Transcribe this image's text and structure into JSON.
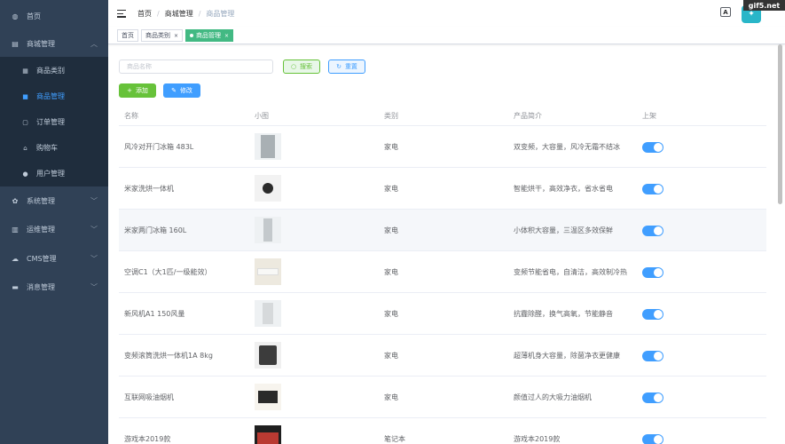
{
  "sidebar": {
    "menu": [
      {
        "label": "首页",
        "icon": "dashboard-icon"
      },
      {
        "label": "商城管理",
        "icon": "shop-icon"
      },
      {
        "label": "系统管理",
        "icon": "gear-icon"
      },
      {
        "label": "运维管理",
        "icon": "monitor-icon"
      },
      {
        "label": "CMS管理",
        "icon": "cloud-icon"
      },
      {
        "label": "消息管理",
        "icon": "message-icon"
      }
    ],
    "submenu": [
      {
        "label": "商品类别",
        "icon": "category-icon"
      },
      {
        "label": "商品管理",
        "icon": "goods-icon"
      },
      {
        "label": "订单管理",
        "icon": "order-icon"
      },
      {
        "label": "购物车",
        "icon": "cart-icon"
      },
      {
        "label": "用户管理",
        "icon": "user-icon"
      }
    ]
  },
  "header": {
    "breadcrumb": [
      "首页",
      "商城管理",
      "商品管理"
    ],
    "breadcrumb_sep": "/",
    "lang_icon_text": "A",
    "watermark": "gif5.net"
  },
  "tags": [
    {
      "label": "首页"
    },
    {
      "label": "商品类别",
      "close": "×"
    },
    {
      "label": "商品管理",
      "close": "×"
    }
  ],
  "toolbar": {
    "search_placeholder": "商品名称",
    "search_label": "搜索",
    "reset_label": "重置",
    "add_label": "添加",
    "edit_label": "修改"
  },
  "table": {
    "columns": [
      "名称",
      "小图",
      "类别",
      "产品简介",
      "上架"
    ],
    "rows": [
      {
        "name": "风冷对开门冰箱 483L",
        "category": "家电",
        "desc": "双变频，大容量，风冷无霜不结冰",
        "on_sale": true
      },
      {
        "name": "米家洗烘一体机",
        "category": "家电",
        "desc": "智能烘干，高效净衣，省水省电",
        "on_sale": true
      },
      {
        "name": "米家两门冰箱 160L",
        "category": "家电",
        "desc": "小体积大容量，三温区多效保鲜",
        "on_sale": true
      },
      {
        "name": "空调C1（大1匹/一级能效）",
        "category": "家电",
        "desc": "变频节能省电，自清洁，高效制冷热",
        "on_sale": true
      },
      {
        "name": "新风机A1 150风量",
        "category": "家电",
        "desc": "抗霾除醛，换气高氧，节能静音",
        "on_sale": true
      },
      {
        "name": "变频滚筒洗烘一体机1A 8kg",
        "category": "家电",
        "desc": "超薄机身大容量，除菌净衣更健康",
        "on_sale": true
      },
      {
        "name": "互联网吸油烟机",
        "category": "家电",
        "desc": "颜值过人的大吸力油烟机",
        "on_sale": true
      },
      {
        "name": "游戏本2019款",
        "category": "笔记本",
        "desc": "游戏本2019款",
        "on_sale": true
      }
    ]
  },
  "colors": {
    "sidebar_bg": "#304156",
    "submenu_bg": "#1f2d3d",
    "active_text": "#409eff",
    "tag_active": "#42b983",
    "success": "#67c23a",
    "primary": "#409eff"
  }
}
